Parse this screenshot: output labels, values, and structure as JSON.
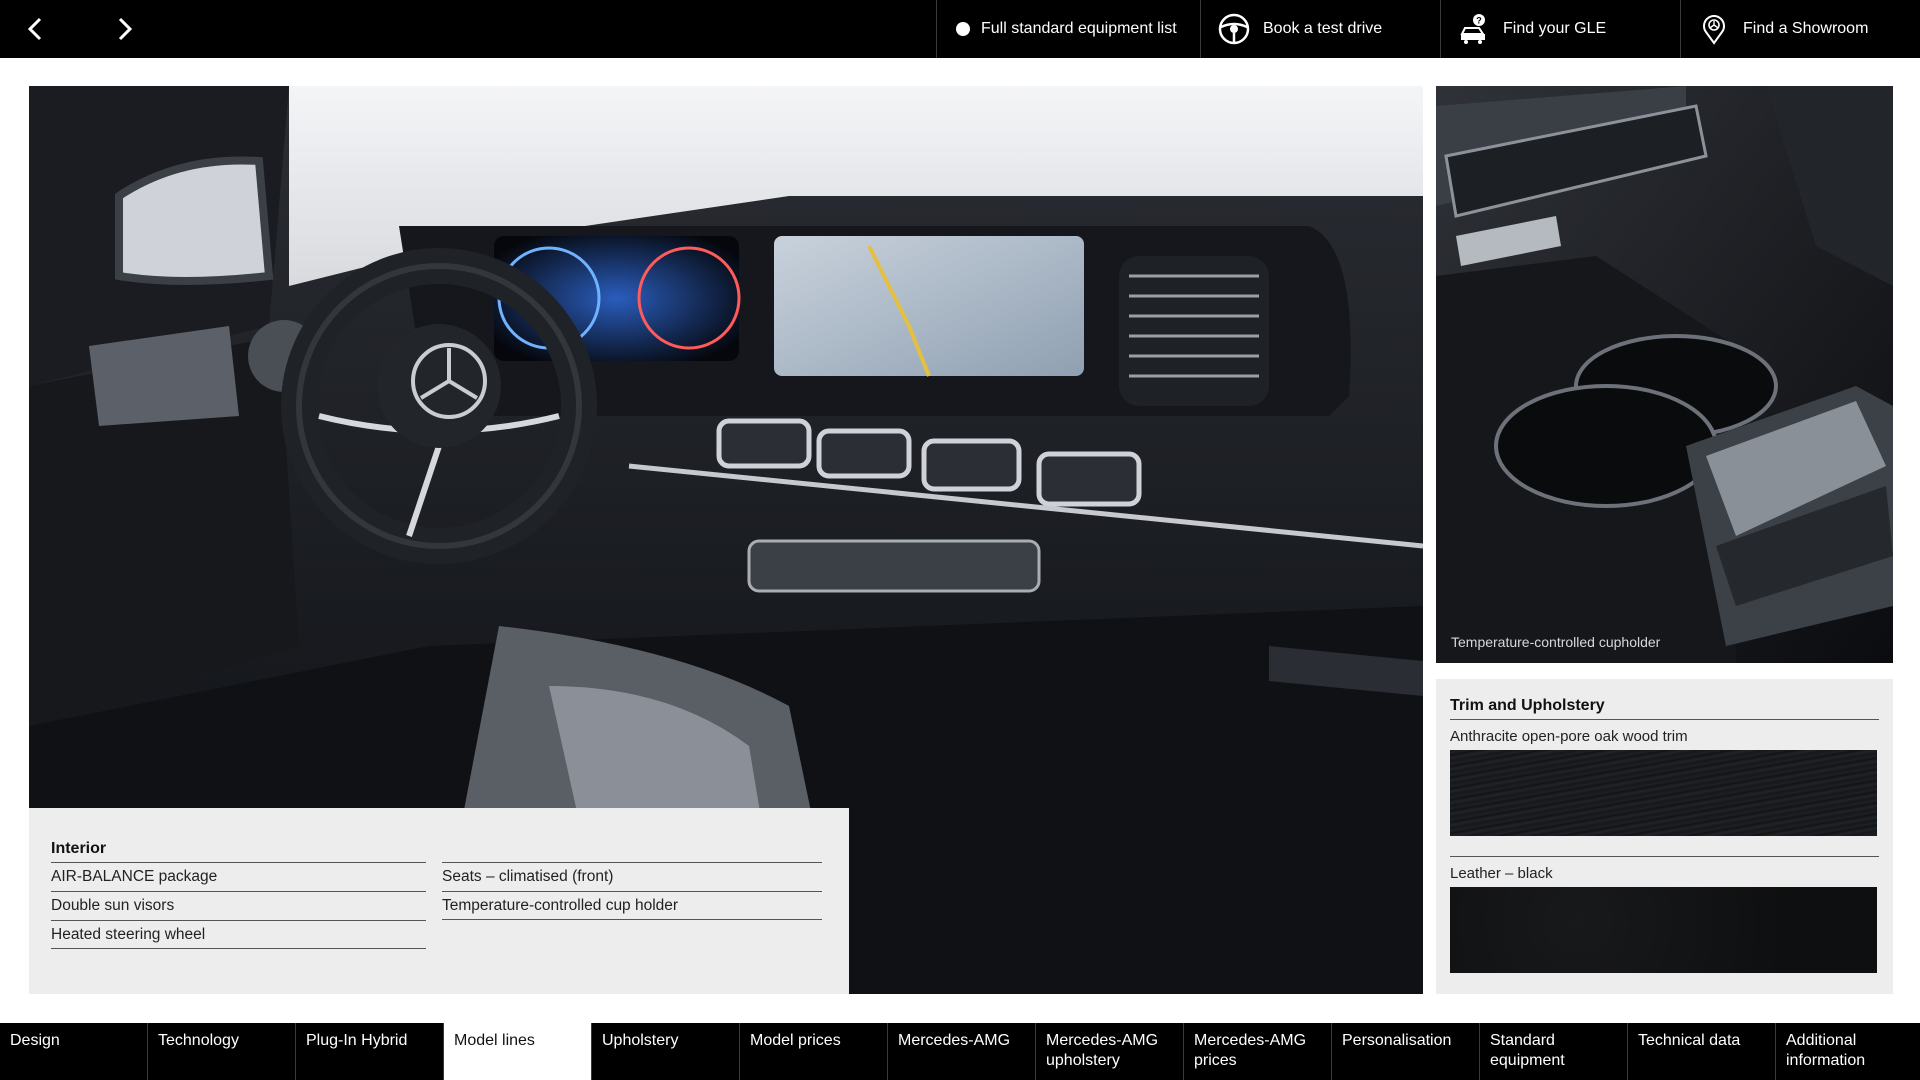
{
  "topbar": {
    "prev_icon": "chevron-left-icon",
    "next_icon": "chevron-right-icon",
    "actions": [
      {
        "label": "Full standard equipment list",
        "icon": "dot-icon"
      },
      {
        "label": "Book a test drive",
        "icon": "steering-wheel-icon"
      },
      {
        "label": "Find your GLE",
        "icon": "car-search-icon"
      },
      {
        "label": "Find a Showroom",
        "icon": "location-pin-icon"
      }
    ]
  },
  "photos": {
    "main_alt": "Dashboard interior",
    "side_caption": "Temperature-controlled cupholder"
  },
  "interior": {
    "title": "Interior",
    "col1": [
      "AIR-BALANCE package",
      "Double sun visors",
      "Heated steering wheel"
    ],
    "col2": [
      "Seats – climatised (front)",
      "Temperature-controlled cup holder"
    ]
  },
  "trim": {
    "title": "Trim and Upholstery",
    "items": [
      {
        "label": "Anthracite open-pore oak wood trim",
        "swatch": "#1b1d20"
      },
      {
        "label": "Leather – black",
        "swatch": "#111213"
      }
    ]
  },
  "tabs": [
    "Design",
    "Technology",
    "Plug-In Hybrid",
    "Model lines",
    "Upholstery",
    "Model prices",
    "Mercedes-AMG",
    "Mercedes-AMG upholstery",
    "Mercedes-AMG prices",
    "Personalisation",
    "Standard equipment",
    "Technical data",
    "Additional information"
  ],
  "active_tab": "Model lines",
  "colors": {
    "bar": "#000000",
    "panel": "#ededed",
    "accent": "#ffffff"
  }
}
